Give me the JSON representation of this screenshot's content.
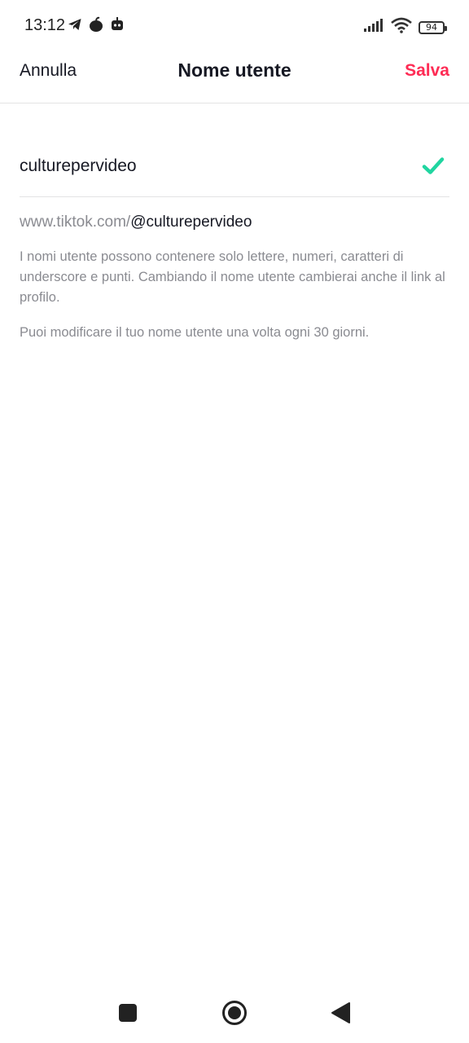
{
  "status_bar": {
    "time": "13:12",
    "battery": "94",
    "left_icons": [
      "telegram-icon",
      "app-icon",
      "notification-icon"
    ],
    "right_icons": [
      "signal-icon",
      "wifi-icon",
      "battery-icon"
    ]
  },
  "header": {
    "cancel_label": "Annulla",
    "title": "Nome utente",
    "save_label": "Salva"
  },
  "username": {
    "value": "culturepervideo",
    "valid": true
  },
  "url": {
    "prefix": "www.tiktok.com/",
    "handle": "@culturepervideo"
  },
  "info": {
    "rules": "I nomi utente possono contenere solo lettere, numeri, caratteri di underscore e punti. Cambiando il nome utente cambierai anche il link al profilo.",
    "frequency": "Puoi modificare il tuo nome utente una volta ogni 30 giorni."
  },
  "navigation": {
    "buttons": [
      "recents-button",
      "home-button",
      "back-button"
    ]
  },
  "colors": {
    "accent": "#fe2c55",
    "valid": "#20d5a0",
    "text": "#161823",
    "secondary_text": "#8a8b91",
    "divider": "#e3e3e4"
  }
}
